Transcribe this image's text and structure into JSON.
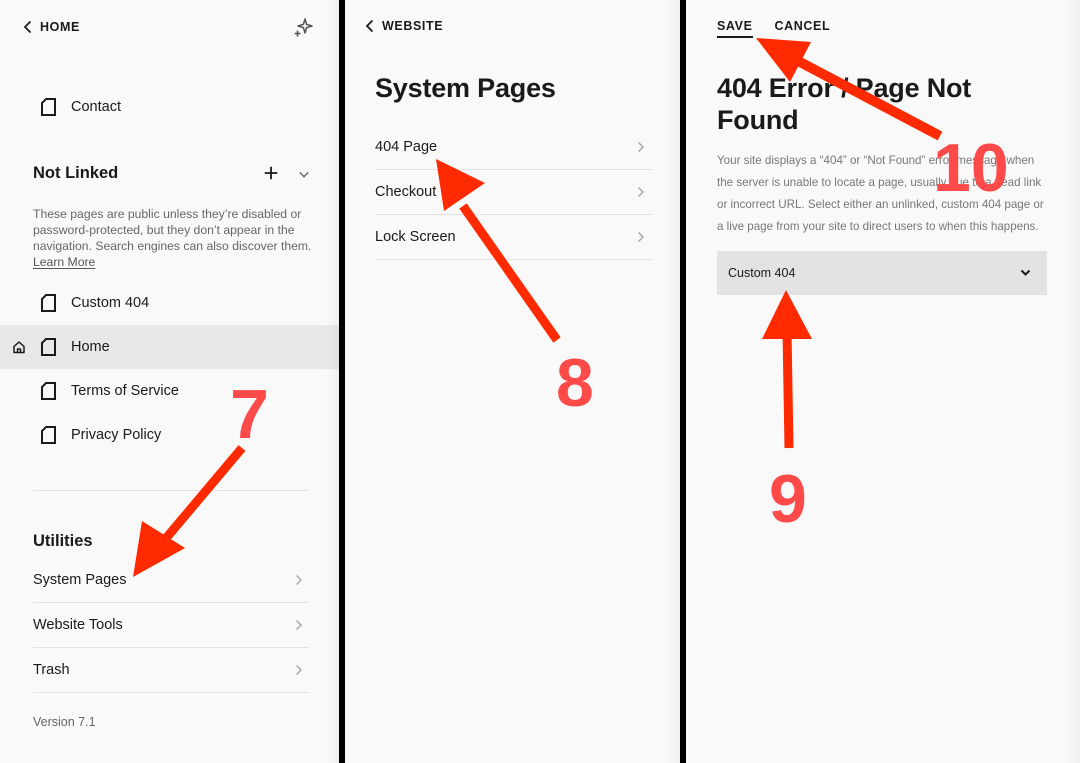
{
  "panel1": {
    "back_label": "HOME",
    "sparkle_icon": "sparkle-icon",
    "linked_pages": [
      {
        "label": "Contact",
        "icon": "page-icon"
      }
    ],
    "not_linked": {
      "title": "Not Linked",
      "description": "These pages are public unless they’re disabled or password-protected, but they don’t appear in the navigation. Search engines can also discover them.",
      "learn_more": "Learn More",
      "pages": [
        {
          "label": "Custom 404",
          "icon": "page-icon",
          "selected": false
        },
        {
          "label": "Home",
          "icon": "page-icon",
          "selected": true,
          "is_homepage": true
        },
        {
          "label": "Terms of Service",
          "icon": "page-icon",
          "selected": false
        },
        {
          "label": "Privacy Policy",
          "icon": "page-icon",
          "selected": false
        }
      ]
    },
    "utilities": {
      "title": "Utilities",
      "items": [
        {
          "label": "System Pages"
        },
        {
          "label": "Website Tools"
        },
        {
          "label": "Trash"
        }
      ]
    },
    "version": "Version 7.1"
  },
  "panel2": {
    "back_label": "WEBSITE",
    "title": "System Pages",
    "items": [
      {
        "label": "404 Page"
      },
      {
        "label": "Checkout"
      },
      {
        "label": "Lock Screen"
      }
    ]
  },
  "panel3": {
    "save_label": "SAVE",
    "cancel_label": "CANCEL",
    "title_line1": "404 Error / Page Not",
    "title_line2": "Found",
    "description": "Your site displays a “404” or “Not Found” error message when the server is unable to locate a page, usually due to a dead link or incorrect URL. Select either an unlinked, custom 404 page or a live page from your site to direct users to when this happens.",
    "select_value": "Custom 404"
  },
  "annotations": {
    "color": "#ff2a00",
    "number_color": "#ff4a4a",
    "steps": [
      "7",
      "8",
      "9",
      "10"
    ]
  }
}
